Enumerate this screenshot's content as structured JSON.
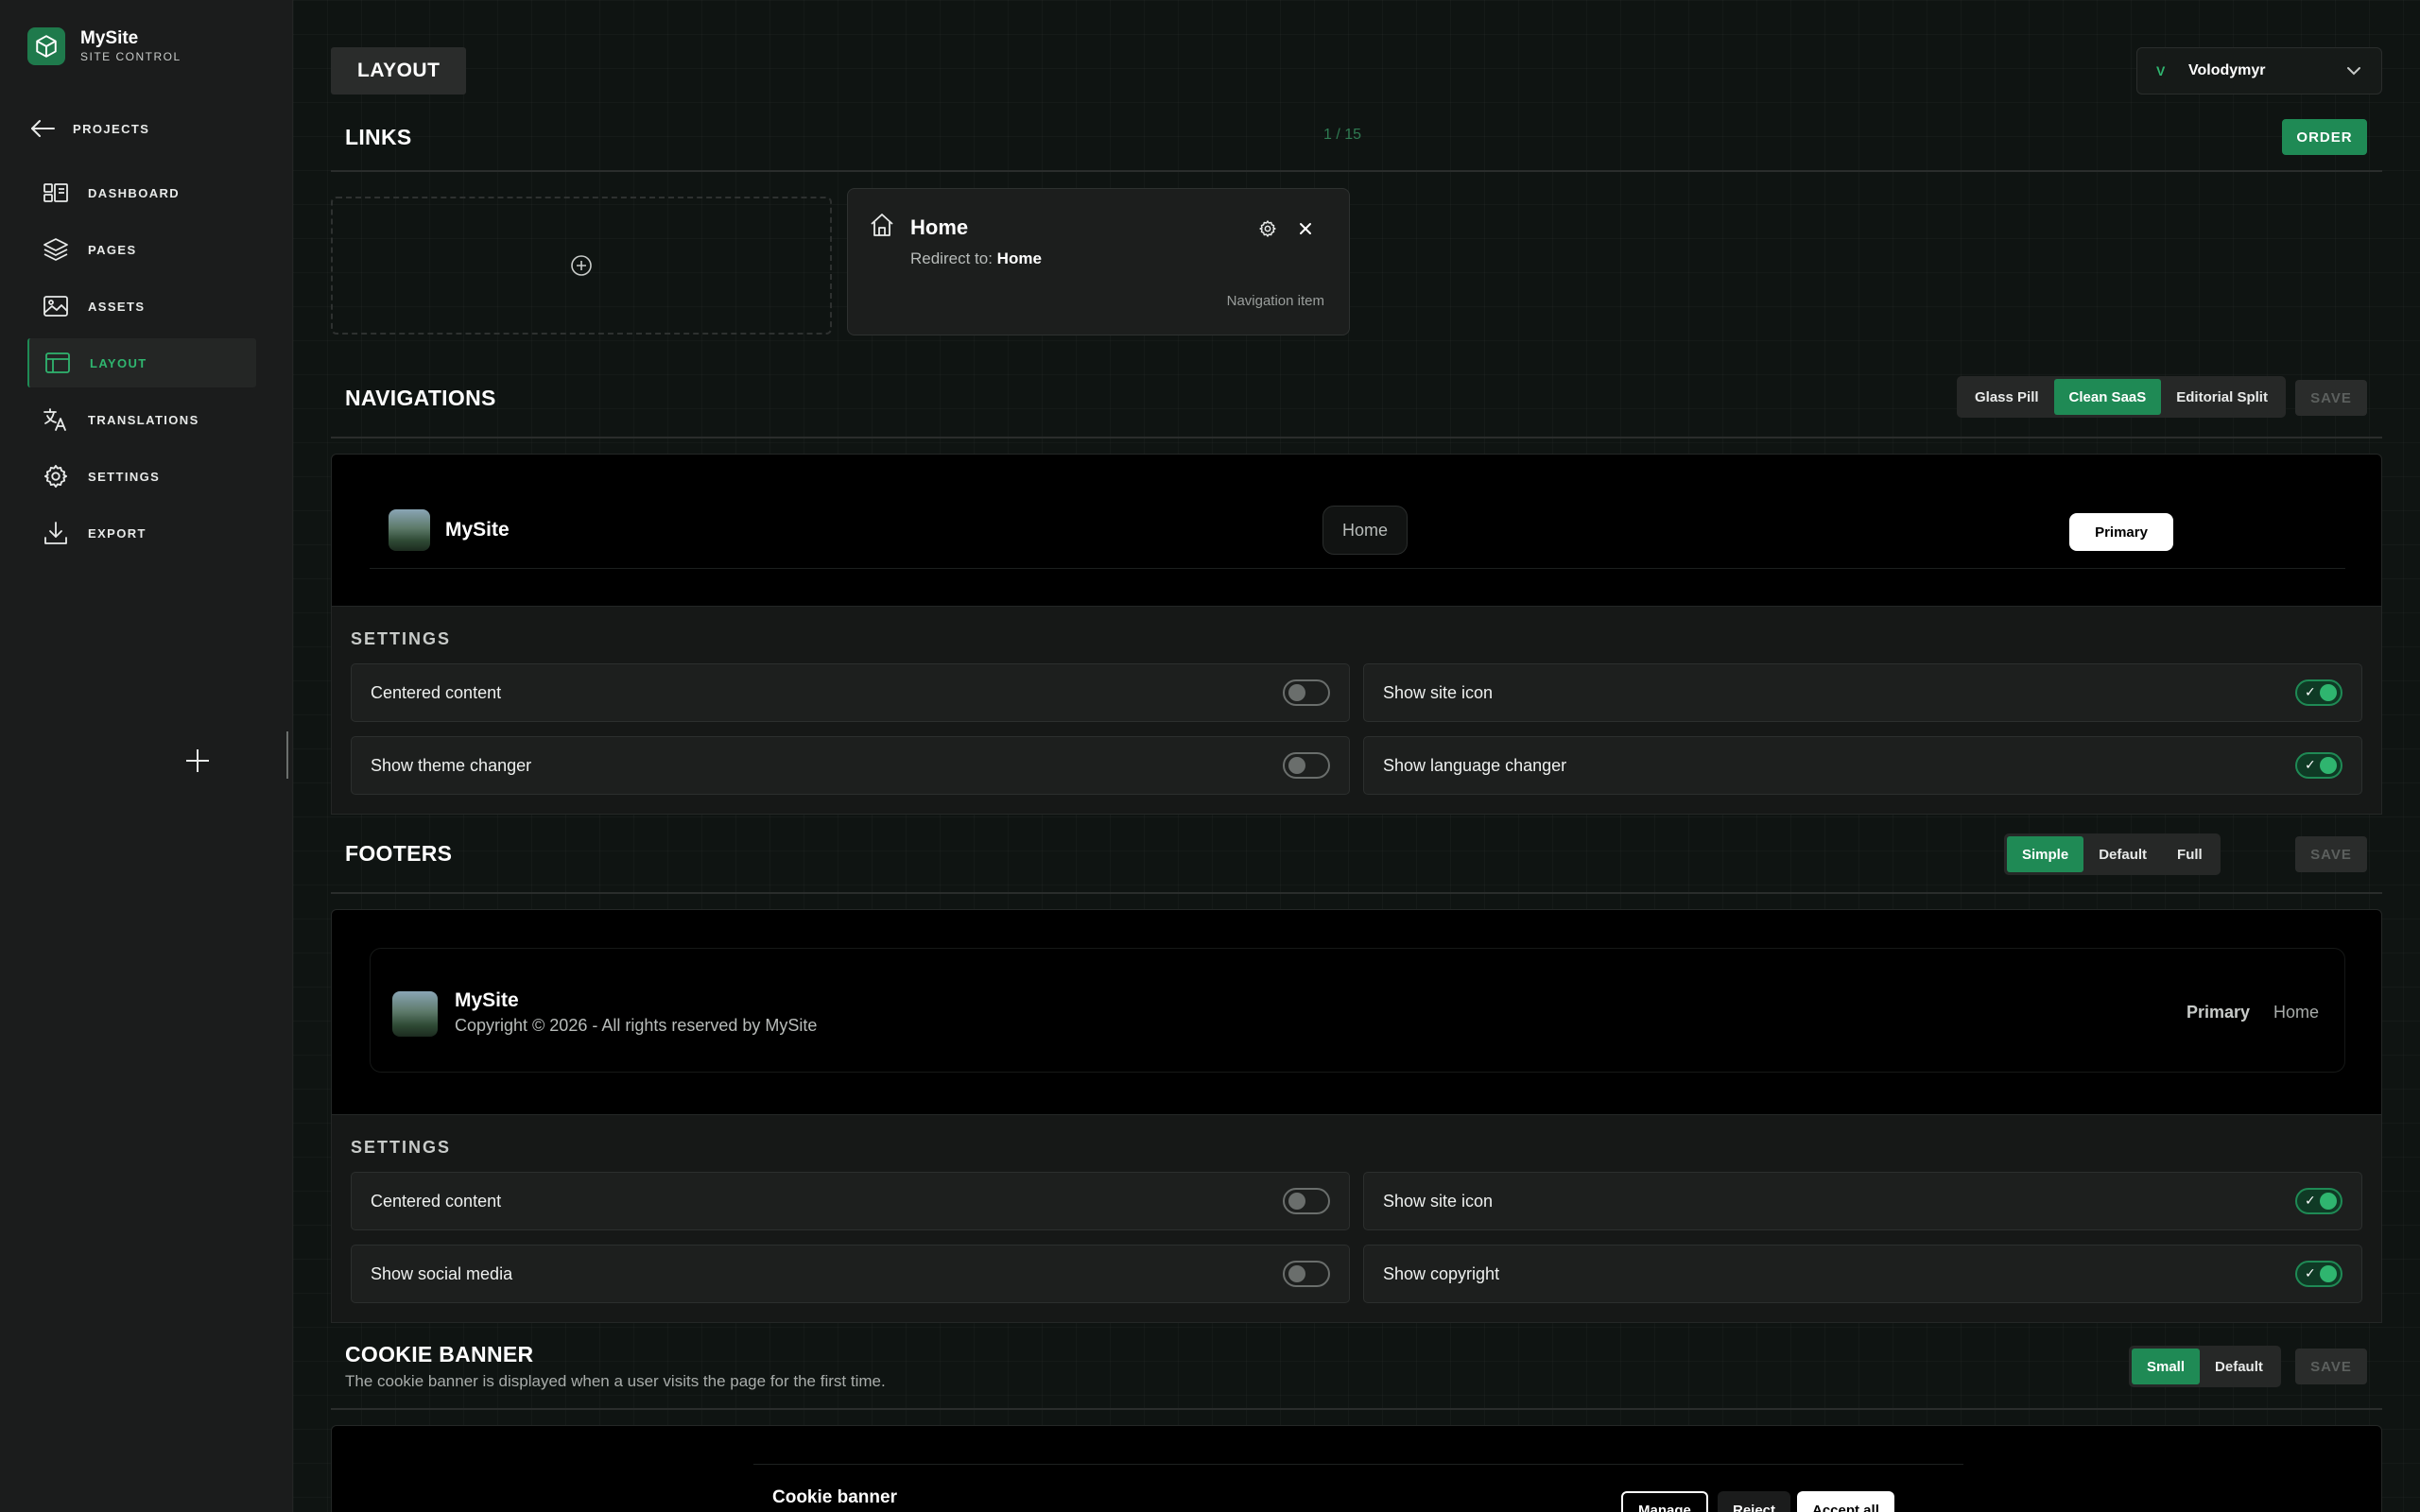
{
  "brand": {
    "name": "MySite",
    "subtitle": "SITE CONTROL"
  },
  "sidebar": {
    "back_label": "PROJECTS",
    "items": [
      {
        "label": "DASHBOARD",
        "icon": "dashboard-icon",
        "active": false
      },
      {
        "label": "PAGES",
        "icon": "layers-icon",
        "active": false
      },
      {
        "label": "ASSETS",
        "icon": "image-icon",
        "active": false
      },
      {
        "label": "LAYOUT",
        "icon": "layout-icon",
        "active": true
      },
      {
        "label": "TRANSLATIONS",
        "icon": "translate-icon",
        "active": false
      },
      {
        "label": "SETTINGS",
        "icon": "gear-icon",
        "active": false
      },
      {
        "label": "EXPORT",
        "icon": "download-icon",
        "active": false
      }
    ]
  },
  "header": {
    "page_title": "LAYOUT",
    "user_initial": "V",
    "user_name": "Volodymyr"
  },
  "links": {
    "title": "LINKS",
    "counter": "1 / 15",
    "order_label": "ORDER",
    "card": {
      "title": "Home",
      "redirect_prefix": "Redirect to:",
      "redirect_target": "Home",
      "meta": "Navigation item"
    }
  },
  "navigations": {
    "title": "NAVIGATIONS",
    "styles": [
      "Glass Pill",
      "Clean SaaS",
      "Editorial Split"
    ],
    "selected_style": "Clean SaaS",
    "save_label": "SAVE",
    "preview": {
      "site_name": "MySite",
      "home_label": "Home",
      "primary_label": "Primary"
    },
    "settings_label": "SETTINGS",
    "settings": [
      {
        "label": "Centered content",
        "on": false
      },
      {
        "label": "Show site icon",
        "on": true
      },
      {
        "label": "Show theme changer",
        "on": false
      },
      {
        "label": "Show language changer",
        "on": true
      }
    ]
  },
  "footers": {
    "title": "FOOTERS",
    "styles": [
      "Simple",
      "Default",
      "Full"
    ],
    "selected_style": "Simple",
    "save_label": "SAVE",
    "preview": {
      "site_name": "MySite",
      "copyright": "Copyright © 2026 - All rights reserved by MySite",
      "link_primary": "Primary",
      "link_home": "Home"
    },
    "settings_label": "SETTINGS",
    "settings": [
      {
        "label": "Centered content",
        "on": false
      },
      {
        "label": "Show site icon",
        "on": true
      },
      {
        "label": "Show social media",
        "on": false
      },
      {
        "label": "Show copyright",
        "on": true
      }
    ]
  },
  "cookie_banner": {
    "title": "COOKIE BANNER",
    "description": "The cookie banner is displayed when a user visits the page for the first time.",
    "styles": [
      "Small",
      "Default"
    ],
    "selected_style": "Small",
    "save_label": "SAVE",
    "preview": {
      "title": "Cookie banner",
      "manage_label": "Manage",
      "reject_label": "Reject",
      "accept_label": "Accept all"
    }
  },
  "colors": {
    "accent": "#1f8a55",
    "accent_text": "#2fb56f",
    "sidebar_bg": "#1b1c1c",
    "main_bg": "#0f1412"
  }
}
